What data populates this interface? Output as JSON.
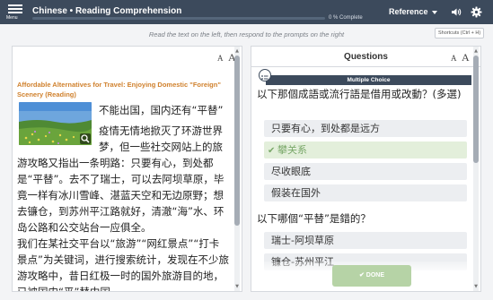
{
  "header": {
    "menu_label": "Menu",
    "title": "Chinese • Reading Comprehension",
    "progress_text": "0 % Complete",
    "progress_value": 0,
    "reference_label": "Reference",
    "icons": [
      "menu-icon",
      "sound-icon",
      "gear-icon"
    ]
  },
  "instructions": "Read the text on the left, then respond to the prompts on the right",
  "shortcuts_label": "Shortcuts (Ctrl + H)",
  "reading": {
    "font_decrease": "A",
    "font_increase": "A",
    "title": "Affordable Alternatives for Travel: Enjoying Domestic \"Foreign\" Scenery (Reading)",
    "para1_line1": "不能出国，国内还有“平替”",
    "para1_line2": "疫情无情地掀灭了环游世界",
    "para1_line3": "梦，但一些社交网站上的旅",
    "para1_rest": "游攻略又指出一条明路：只要有心，到处都是“平替”。去不了瑞士，可以去阿坝草原，毕竟一样有冰川雪峰、湛蓝天空和无边原野；想去镰仓，到苏州平江路就好，清澈“海”水、环岛公路和公交站台一应俱全。",
    "para2": "我们在某社交平台以“旅游”“网红景点”“打卡景点”为关键词，进行搜索统计，发现在不少旅游攻略中，昔日红极一时的国外旅游目的地，已被国内“平”替中国"
  },
  "questions": {
    "header": "Questions",
    "font_decrease": "A",
    "font_increase": "A",
    "section_label": "Multiple Choice",
    "q1_text": "以下那個成語或流行語是借用或改動？(多選)",
    "q1_choices": [
      {
        "label": "只要有心，到处都是远方",
        "selected": false
      },
      {
        "label": "攀关系",
        "selected": true
      },
      {
        "label": "尽收眼底",
        "selected": false
      },
      {
        "label": "假装在国外",
        "selected": false
      }
    ],
    "q2_text": "以下哪個“平替”是錯的？",
    "q2_choices": [
      {
        "label": "瑞士-阿坝草原"
      },
      {
        "label": "镰仓-苏州平江"
      }
    ],
    "done_label": "DONE"
  }
}
